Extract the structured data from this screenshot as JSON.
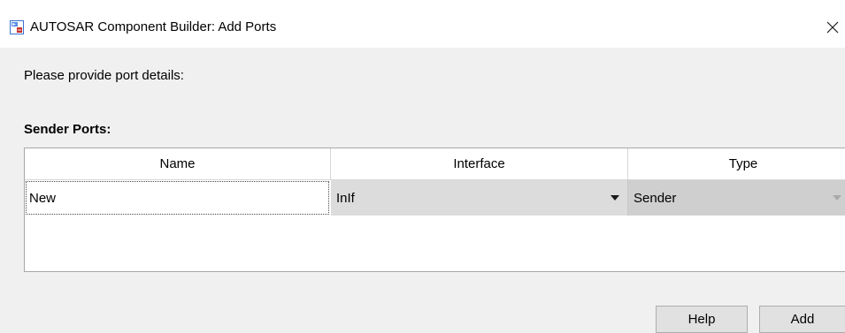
{
  "window": {
    "title": "AUTOSAR Component Builder: Add Ports",
    "close_glyph": "✕"
  },
  "prompt": "Please provide port details:",
  "section": {
    "label": "Sender Ports:"
  },
  "table": {
    "columns": [
      "Name",
      "Interface",
      "Type"
    ],
    "rows": [
      {
        "name": "New",
        "interface": "InIf",
        "type": "Sender"
      }
    ]
  },
  "buttons": {
    "help_label": "Help",
    "add_label": "Add"
  },
  "icons": {
    "app": "simulink-icon",
    "close": "close-icon",
    "dropdown": "chevron-down-icon"
  },
  "colors": {
    "titlebar": "#ffffff",
    "background": "#f0f0f0",
    "icon_red": "#c4322a",
    "icon_blue": "#3b6fd1"
  }
}
